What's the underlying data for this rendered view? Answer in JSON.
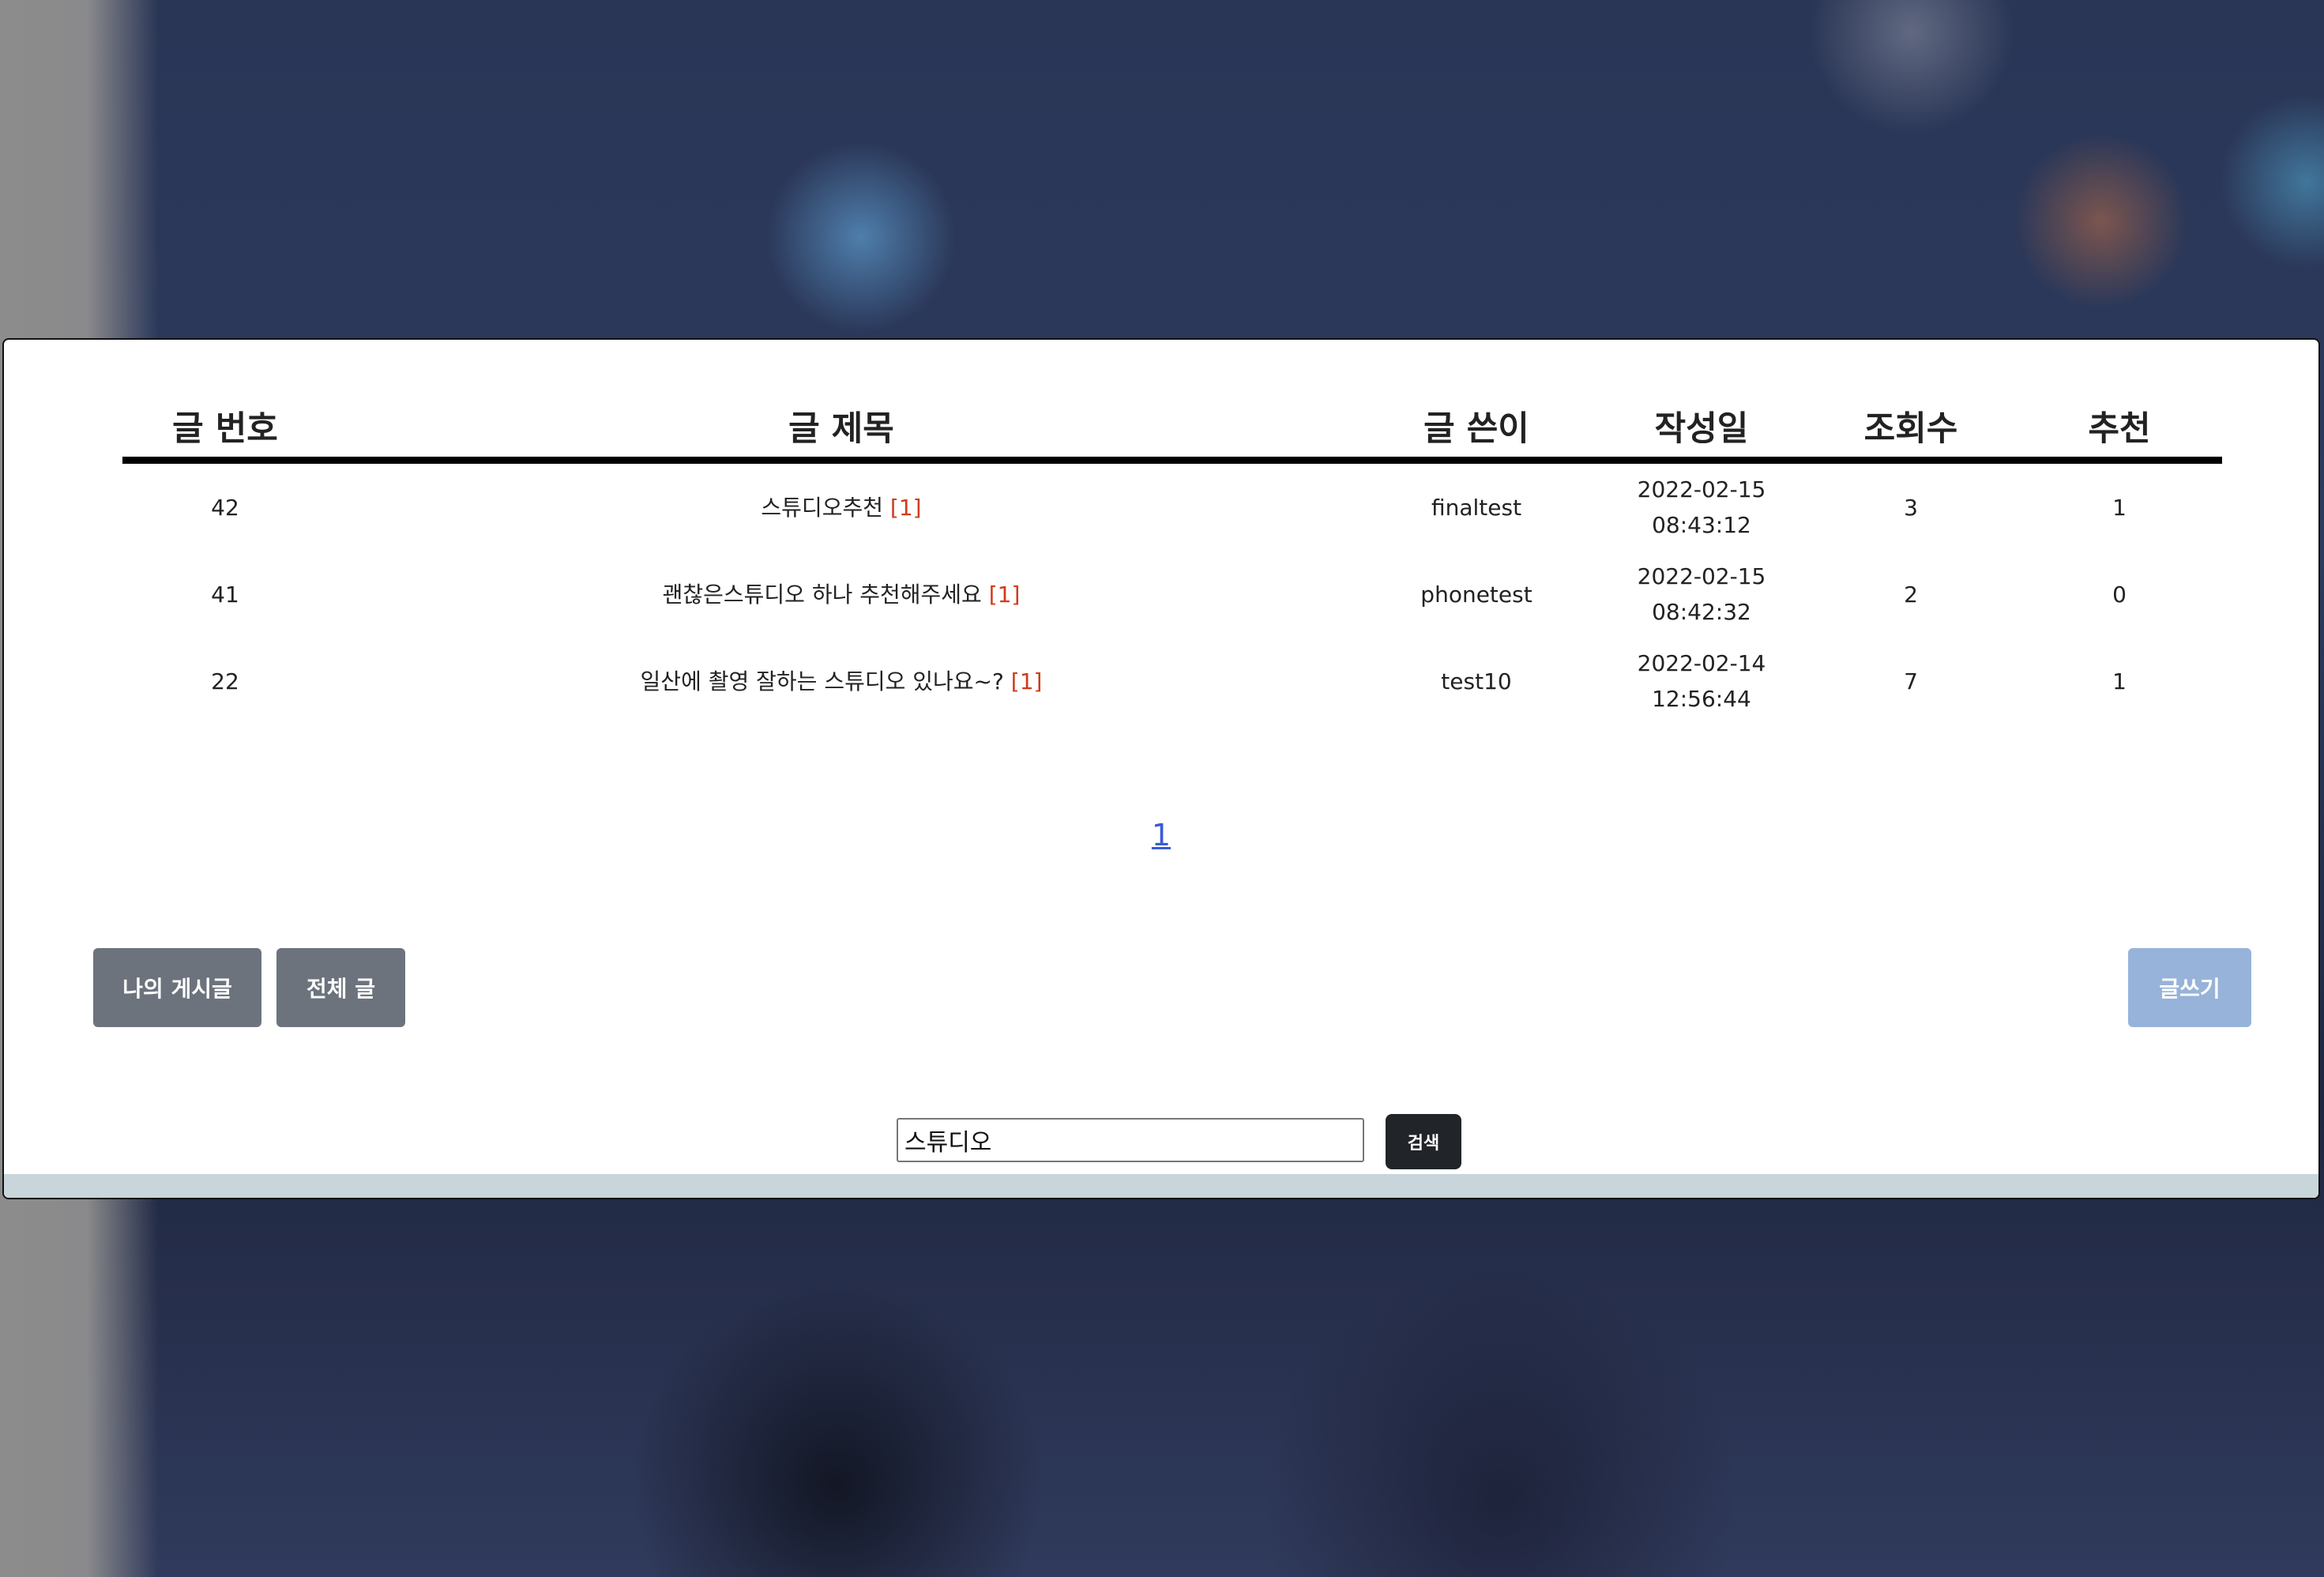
{
  "table": {
    "headers": {
      "number": "글 번호",
      "title": "글 제목",
      "author": "글 쓴이",
      "date": "작성일",
      "views": "조회수",
      "likes": "추천"
    },
    "rows": [
      {
        "number": "42",
        "title": "스튜디오추천",
        "comments": "[1]",
        "author": "finaltest",
        "date": "2022-02-15",
        "time": "08:43:12",
        "views": "3",
        "likes": "1"
      },
      {
        "number": "41",
        "title": "괜찮은스튜디오 하나 추천해주세요",
        "comments": "[1]",
        "author": "phonetest",
        "date": "2022-02-15",
        "time": "08:42:32",
        "views": "2",
        "likes": "0"
      },
      {
        "number": "22",
        "title": "일산에 촬영 잘하는 스튜디오 있나요~?",
        "comments": "[1]",
        "author": "test10",
        "date": "2022-02-14",
        "time": "12:56:44",
        "views": "7",
        "likes": "1"
      }
    ]
  },
  "pagination": {
    "pages": [
      "1"
    ]
  },
  "buttons": {
    "my_posts": "나의 게시글",
    "all_posts": "전체 글",
    "write": "글쓰기"
  },
  "search": {
    "value": "스튜디오",
    "button_label": "검색"
  },
  "colors": {
    "comment_count": "#d13b1c",
    "page_link": "#3a5bd4",
    "write_button": "#98b3d9",
    "gray_button": "#6c737d",
    "search_button": "#212529"
  }
}
